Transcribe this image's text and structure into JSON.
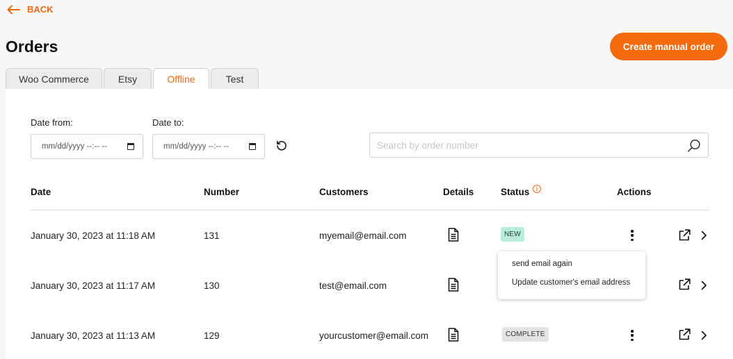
{
  "nav": {
    "back_label": "BACK"
  },
  "page": {
    "title": "Orders",
    "create_button": "Create manual order"
  },
  "tabs": [
    {
      "label": "Woo Commerce",
      "active": false
    },
    {
      "label": "Etsy",
      "active": false
    },
    {
      "label": "Offline",
      "active": true
    },
    {
      "label": "Test",
      "active": false
    }
  ],
  "filters": {
    "date_from_label": "Date from:",
    "date_to_label": "Date to:",
    "date_placeholder": "mm/dd/yyyy --:-- --",
    "search_placeholder": "Search by order number"
  },
  "table": {
    "headers": {
      "date": "Date",
      "number": "Number",
      "customers": "Customers",
      "details": "Details",
      "status": "Status",
      "actions": "Actions"
    },
    "rows": [
      {
        "date": "January 30, 2023 at 11:18 AM",
        "number": "131",
        "customer": "myemail@email.com",
        "status": "NEW"
      },
      {
        "date": "January 30, 2023 at 11:17 AM",
        "number": "130",
        "customer": "test@email.com",
        "status": ""
      },
      {
        "date": "January 30, 2023 at 11:13 AM",
        "number": "129",
        "customer": "yourcustomer@email.com",
        "status": "COMPLETE"
      }
    ]
  },
  "actions_menu": {
    "items": [
      "send email again",
      "Update customer's email address"
    ]
  },
  "colors": {
    "accent": "#f26a0f",
    "badge_new": "#b9ecd9",
    "badge_complete": "#e3e3e6"
  },
  "icons": [
    "arrow-left-icon",
    "calendar-icon",
    "refresh-icon",
    "search-icon",
    "info-icon",
    "document-icon",
    "more-vertical-icon",
    "external-link-icon",
    "chevron-right-icon"
  ]
}
